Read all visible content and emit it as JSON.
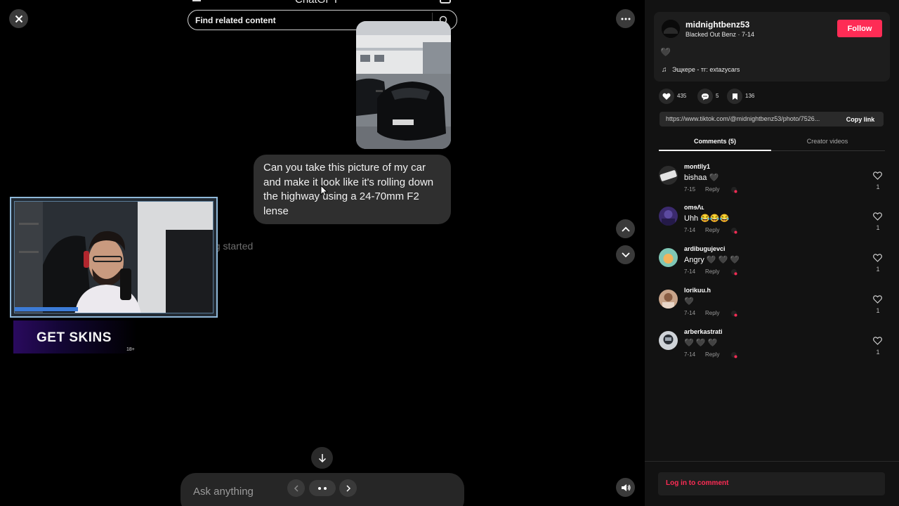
{
  "viewer": {
    "chat_title": "ChatGPT",
    "search_placeholder": "Find related content",
    "user_message": "Can you take this picture of my car and make it look like it's rolling down the highway using a 24-70mm F2 lense",
    "faded_text": "ng started",
    "ask_placeholder": "Ask anything",
    "skins_banner": "GET SKINS",
    "age_label": "18+"
  },
  "post": {
    "username": "midnightbenz53",
    "subtitle": "Blacked Out Benz · 7-14",
    "follow_label": "Follow",
    "caption": "🖤",
    "music": "Эщкере - тг: extazycars",
    "likes": "435",
    "comments": "5",
    "saves": "136",
    "link": "https://www.tiktok.com/@midnightbenz53/photo/7526...",
    "copy_link_label": "Copy link"
  },
  "tabs": {
    "comments": "Comments (5)",
    "creator_videos": "Creator videos"
  },
  "comments": [
    {
      "user": "montlly1",
      "text": "bishaa 🖤",
      "date": "7-15",
      "reply": "Reply",
      "likes": "1",
      "avatar_color": "#d8d8d8"
    },
    {
      "user": "omɘɅʟ",
      "text": "Uhh 😂😂😂",
      "date": "7-14",
      "reply": "Reply",
      "likes": "1",
      "avatar_color": "#3b2a6e"
    },
    {
      "user": "ardibugujevci",
      "text": "Angry 🖤 🖤 🖤",
      "date": "7-14",
      "reply": "Reply",
      "likes": "1",
      "avatar_color": "#7fc7b5"
    },
    {
      "user": "lorikuu.h",
      "text": "🖤",
      "date": "7-14",
      "reply": "Reply",
      "likes": "1",
      "avatar_color": "#c8a48a"
    },
    {
      "user": "arberkastrati",
      "text": "🖤 🖤 🖤",
      "date": "7-14",
      "reply": "Reply",
      "likes": "1",
      "avatar_color": "#cfd3d8"
    }
  ],
  "login_label": "Log in to comment",
  "colors": {
    "accent": "#fe2c55",
    "panel_bg": "#121212",
    "viewer_bg": "#000000"
  }
}
